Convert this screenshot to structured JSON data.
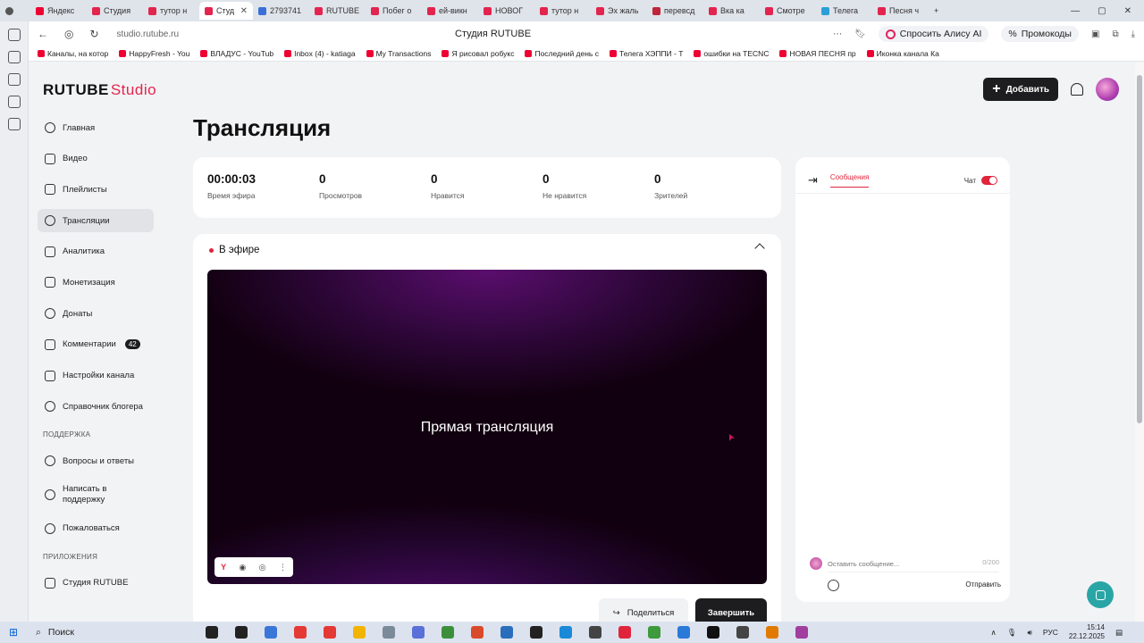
{
  "browser": {
    "tabs": [
      {
        "label": "Яндекс",
        "color": "#e03"
      },
      {
        "label": "Студия",
        "color": "#e3244e"
      },
      {
        "label": "тутор н",
        "color": "#e3244e"
      },
      {
        "label": "Студ",
        "color": "#e3244e",
        "active": true
      },
      {
        "label": "2793741",
        "color": "#3a6fd8"
      },
      {
        "label": "RUTUBE",
        "color": "#e3244e"
      },
      {
        "label": "Побег о",
        "color": "#e3244e"
      },
      {
        "label": "ей-викн",
        "color": "#e3244e"
      },
      {
        "label": "НОВОГ",
        "color": "#e3244e"
      },
      {
        "label": "тутор н",
        "color": "#e3244e"
      },
      {
        "label": "Эх жаль",
        "color": "#e3244e"
      },
      {
        "label": "перевсд",
        "color": "#c0243b"
      },
      {
        "label": "Вка ка",
        "color": "#e3244e"
      },
      {
        "label": "Смотре",
        "color": "#e3244e"
      },
      {
        "label": "Телега",
        "color": "#2a9fd8"
      },
      {
        "label": "Песня ч",
        "color": "#e3244e"
      }
    ],
    "url": "studio.rutube.ru",
    "page_title": "Студия RUTUBE",
    "alice_label": "Спросить Алису AI",
    "promo_label": "Промокоды",
    "bookmarks": [
      "Каналы, на котор",
      "HappyFresh - You",
      "ВЛАДУС - YouTub",
      "Inbox (4) - katiaga",
      "My Transactions",
      "Я рисовал робукс",
      "Последний день с",
      "Телега ХЭППИ - T",
      "ошибки на TECNC",
      "НОВАЯ ПЕСНЯ пр",
      "Иконка канала Ка"
    ]
  },
  "app": {
    "logo_main": "RUTUBE",
    "logo_suffix": "Studio",
    "add_button": "Добавить",
    "page_title": "Трансляция"
  },
  "sidebar": {
    "items": [
      {
        "label": "Главная",
        "icon": "home-icon"
      },
      {
        "label": "Видео",
        "icon": "video-icon"
      },
      {
        "label": "Плейлисты",
        "icon": "playlist-icon"
      },
      {
        "label": "Трансляции",
        "icon": "broadcast-icon"
      },
      {
        "label": "Аналитика",
        "icon": "analytics-icon"
      },
      {
        "label": "Монетизация",
        "icon": "ruble-icon"
      },
      {
        "label": "Донаты",
        "icon": "donate-icon"
      },
      {
        "label": "Комментарии",
        "icon": "comments-icon",
        "badge": "42"
      },
      {
        "label": "Настройки канала",
        "icon": "settings-icon"
      },
      {
        "label": "Справочник блогера",
        "icon": "help-icon"
      }
    ],
    "support_label": "ПОДДЕРЖКА",
    "support_items": [
      {
        "label": "Вопросы и ответы"
      },
      {
        "label": "Написать в поддержку"
      },
      {
        "label": "Пожаловаться"
      }
    ],
    "apps_label": "ПРИЛОЖЕНИЯ",
    "apps_items": [
      {
        "label": "Студия RUTUBE"
      }
    ]
  },
  "stats": [
    {
      "value": "00:00:03",
      "label": "Время эфира"
    },
    {
      "value": "0",
      "label": "Просмотров"
    },
    {
      "value": "0",
      "label": "Нравится"
    },
    {
      "value": "0",
      "label": "Не нравится"
    },
    {
      "value": "0",
      "label": "Зрителей"
    }
  ],
  "live": {
    "status": "В эфире",
    "caption": "Прямая трансляция",
    "share_button": "Поделиться",
    "end_button": "Завершить"
  },
  "chat": {
    "tab_label": "Сообщения",
    "toggle_label": "Чат",
    "toggle_on": true,
    "input_placeholder": "Оставить сообщение...",
    "counter": "0/200",
    "send_label": "Отправить"
  },
  "taskbar": {
    "search_label": "Поиск",
    "lang": "РУС",
    "time": "15:14",
    "date": "22.12.2025"
  }
}
